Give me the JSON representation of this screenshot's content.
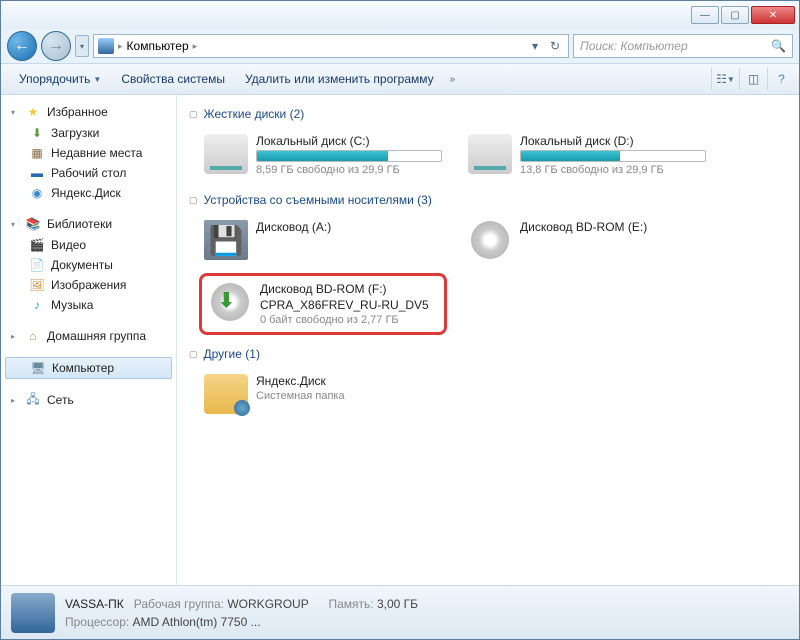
{
  "breadcrumb": {
    "computer": "Компьютер"
  },
  "search": {
    "placeholder": "Поиск: Компьютер"
  },
  "toolbar": {
    "organize": "Упорядочить",
    "sysprops": "Свойства системы",
    "uninstall": "Удалить или изменить программу"
  },
  "sidebar": {
    "favorites": "Избранное",
    "downloads": "Загрузки",
    "recent": "Недавние места",
    "desktop": "Рабочий стол",
    "yadisk": "Яндекс.Диск",
    "libraries": "Библиотеки",
    "video": "Видео",
    "documents": "Документы",
    "images": "Изображения",
    "music": "Музыка",
    "homegroup": "Домашняя группа",
    "computer": "Компьютер",
    "network": "Сеть"
  },
  "groups": {
    "hdd": {
      "title": "Жесткие диски (2)"
    },
    "removable": {
      "title": "Устройства со съемными носителями (3)"
    },
    "other": {
      "title": "Другие (1)"
    }
  },
  "drives": {
    "c": {
      "name": "Локальный диск (C:)",
      "sub": "8,59 ГБ свободно из 29,9 ГБ",
      "fill": 71
    },
    "d": {
      "name": "Локальный диск (D:)",
      "sub": "13,8 ГБ свободно из 29,9 ГБ",
      "fill": 54
    },
    "a": {
      "name": "Дисковод (A:)"
    },
    "e": {
      "name": "Дисковод BD-ROM (E:)"
    },
    "f": {
      "name": "Дисковод BD-ROM (F:)",
      "label": "CPRA_X86FREV_RU-RU_DV5",
      "sub": "0 байт свободно из 2,77 ГБ"
    },
    "yd": {
      "name": "Яндекс.Диск",
      "sub": "Системная папка"
    }
  },
  "status": {
    "pcname": "VASSA-ПК",
    "wg_lbl": "Рабочая группа:",
    "wg": "WORKGROUP",
    "mem_lbl": "Память:",
    "mem": "3,00 ГБ",
    "cpu_lbl": "Процессор:",
    "cpu": "AMD Athlon(tm) 7750 ..."
  }
}
